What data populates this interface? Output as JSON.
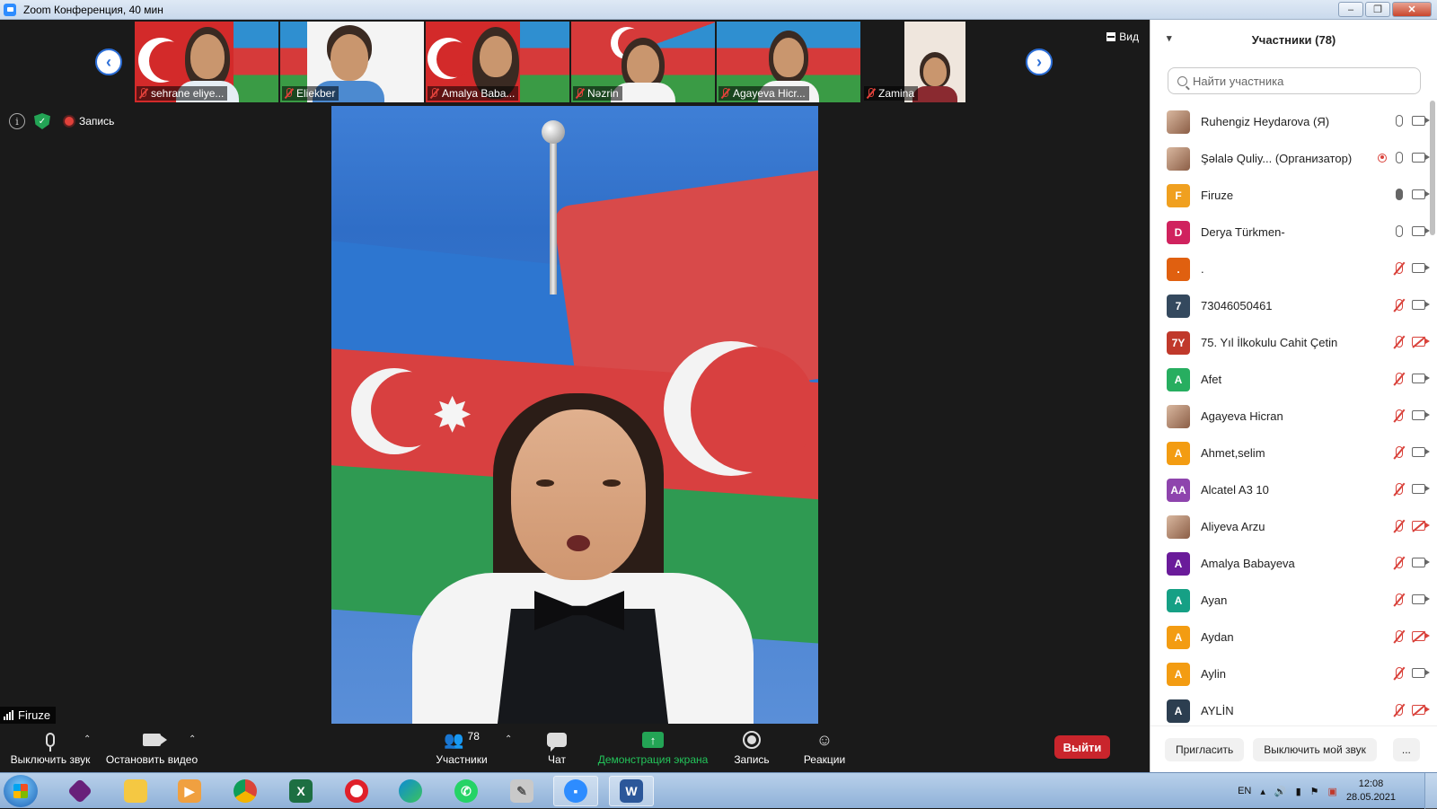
{
  "window": {
    "title": "Zoom Конференция, 40 мин",
    "controls": [
      "minimize",
      "restore",
      "close"
    ]
  },
  "gallery": {
    "thumbnails": [
      {
        "name": "sehrane eliye...",
        "muted": true
      },
      {
        "name": "Eliekber",
        "muted": true
      },
      {
        "name": "Amalya Baba...",
        "muted": true
      },
      {
        "name": "Nəzrin",
        "muted": true
      },
      {
        "name": "Agayeva Hicr...",
        "muted": true
      },
      {
        "name": "Zamina",
        "muted": true
      }
    ],
    "view_label": "Вид"
  },
  "status": {
    "recording_label": "Запись"
  },
  "speaker": {
    "name": "Firuze"
  },
  "toolbar": {
    "mute_label": "Выключить звук",
    "video_label": "Остановить видео",
    "participants_label": "Участники",
    "participants_count": "78",
    "chat_label": "Чат",
    "share_label": "Демонстрация экрана",
    "record_label": "Запись",
    "reactions_label": "Реакции",
    "leave_label": "Выйти"
  },
  "panel": {
    "title": "Участники (78)",
    "search_placeholder": "Найти участника",
    "participants": [
      {
        "name": "Ruhengiz Heydarova (Я)",
        "avatar": "photo",
        "initials": "",
        "color": "",
        "mic": "on",
        "cam": "on"
      },
      {
        "name": "Şəlalə Quliy...  (Организатор)",
        "avatar": "photo",
        "initials": "",
        "color": "",
        "mic": "on",
        "cam": "on",
        "recording": true
      },
      {
        "name": "Firuze",
        "avatar": "initials",
        "initials": "F",
        "color": "#f0a020",
        "mic": "active",
        "cam": "on"
      },
      {
        "name": "Derya Türkmen-",
        "avatar": "initials",
        "initials": "D",
        "color": "#d0225e",
        "mic": "on",
        "cam": "on"
      },
      {
        "name": ".",
        "avatar": "initials",
        "initials": ".",
        "color": "#e06010",
        "mic": "muted",
        "cam": "on"
      },
      {
        "name": "73046050461",
        "avatar": "initials",
        "initials": "7",
        "color": "#34495e",
        "mic": "muted",
        "cam": "on"
      },
      {
        "name": "75. Yıl İlkokulu Cahit Çetin",
        "avatar": "initials",
        "initials": "7Y",
        "color": "#c0392b",
        "mic": "muted",
        "cam": "off"
      },
      {
        "name": "Afet",
        "avatar": "initials",
        "initials": "A",
        "color": "#27ae60",
        "mic": "muted",
        "cam": "on"
      },
      {
        "name": "Agayeva Hicran",
        "avatar": "photo",
        "initials": "",
        "color": "",
        "mic": "muted",
        "cam": "on"
      },
      {
        "name": "Ahmet,selim",
        "avatar": "initials",
        "initials": "A",
        "color": "#f39c12",
        "mic": "muted",
        "cam": "on"
      },
      {
        "name": "Alcatel A3 10",
        "avatar": "initials",
        "initials": "AA",
        "color": "#8e44ad",
        "mic": "muted",
        "cam": "on"
      },
      {
        "name": "Aliyeva Arzu",
        "avatar": "photo",
        "initials": "",
        "color": "",
        "mic": "muted",
        "cam": "off"
      },
      {
        "name": "Amalya Babayeva",
        "avatar": "initials",
        "initials": "A",
        "color": "#6a1b9a",
        "mic": "muted",
        "cam": "on"
      },
      {
        "name": "Ayan",
        "avatar": "initials",
        "initials": "A",
        "color": "#16a085",
        "mic": "muted",
        "cam": "on"
      },
      {
        "name": "Aydan",
        "avatar": "initials",
        "initials": "A",
        "color": "#f39c12",
        "mic": "muted",
        "cam": "off"
      },
      {
        "name": "Aylin",
        "avatar": "initials",
        "initials": "A",
        "color": "#f39c12",
        "mic": "muted",
        "cam": "on"
      },
      {
        "name": "AYLİN",
        "avatar": "initials",
        "initials": "A",
        "color": "#2c3e50",
        "mic": "muted",
        "cam": "off"
      }
    ],
    "footer": {
      "invite_label": "Пригласить",
      "mute_me_label": "Выключить мой звук",
      "more_label": "..."
    }
  },
  "taskbar": {
    "apps": [
      "windows-start",
      "visual-studio",
      "file-explorer",
      "media-player",
      "chrome",
      "excel",
      "opera",
      "edge",
      "whatsapp",
      "notepad-tool",
      "zoom",
      "word"
    ],
    "language": "EN",
    "time": "12:08",
    "date": "28.05.2021"
  }
}
